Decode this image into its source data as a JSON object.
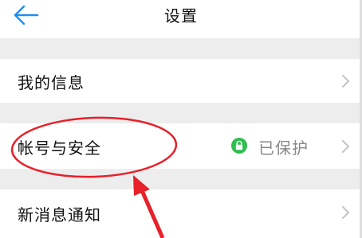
{
  "header": {
    "title": "设置",
    "back_icon": "back-arrow-icon"
  },
  "settings": {
    "items": [
      {
        "label": "我的信息",
        "icon": "chevron-right-icon"
      },
      {
        "label": "帐号与安全",
        "status_text": "已保护",
        "status_icon": "lock-icon",
        "icon": "chevron-right-icon"
      },
      {
        "label": "新消息通知",
        "icon": "chevron-right-icon"
      }
    ]
  },
  "colors": {
    "accent": "#1e8ef0",
    "status_green": "#2ebd4e",
    "annotation_red": "#e8202a",
    "background": "#ededed"
  }
}
